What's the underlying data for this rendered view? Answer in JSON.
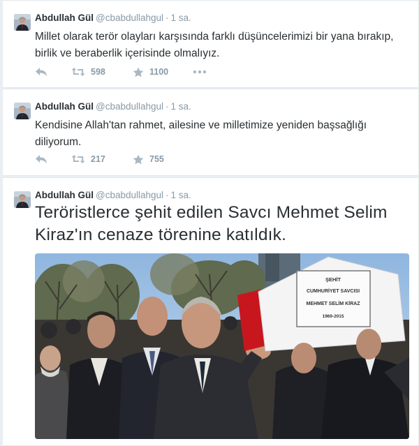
{
  "tweets": [
    {
      "name": "Abdullah Gül",
      "handle": "@cbabdullahgul",
      "separator": "·",
      "time": "1 sa.",
      "text": "Millet olarak terör olayları karşısında farklı düşüncelerimizi bir yana bırakıp, birlik ve beraberlik içerisinde olmalıyız.",
      "retweets": "598",
      "favorites": "1100"
    },
    {
      "name": "Abdullah Gül",
      "handle": "@cbabdullahgul",
      "separator": "·",
      "time": "1 sa.",
      "text": "Kendisine Allah'tan rahmet, ailesine ve milletimize yeniden başsağlığı diliyorum.",
      "retweets": "217",
      "favorites": "755"
    },
    {
      "name": "Abdullah Gül",
      "handle": "@cbabdullahgul",
      "separator": "·",
      "time": "1 sa.",
      "text": "Teröristlerce şehit edilen Savcı Mehmet Selim Kiraz'ın cenaze törenine katıldık.",
      "photo_sign": {
        "line1": "ŞEHİT",
        "line2": "CUMHURİYET SAVCISI",
        "line3": "MEHMET SELİM KİRAZ",
        "line4": "1969-2015"
      }
    }
  ],
  "icons": {
    "reply": "reply-icon",
    "retweet": "retweet-icon",
    "favorite": "star-icon",
    "more": "more-icon"
  },
  "colors": {
    "background": "#e9eef2",
    "text": "#292f33",
    "muted": "#8899a6",
    "action_icon": "#aab8c2"
  }
}
